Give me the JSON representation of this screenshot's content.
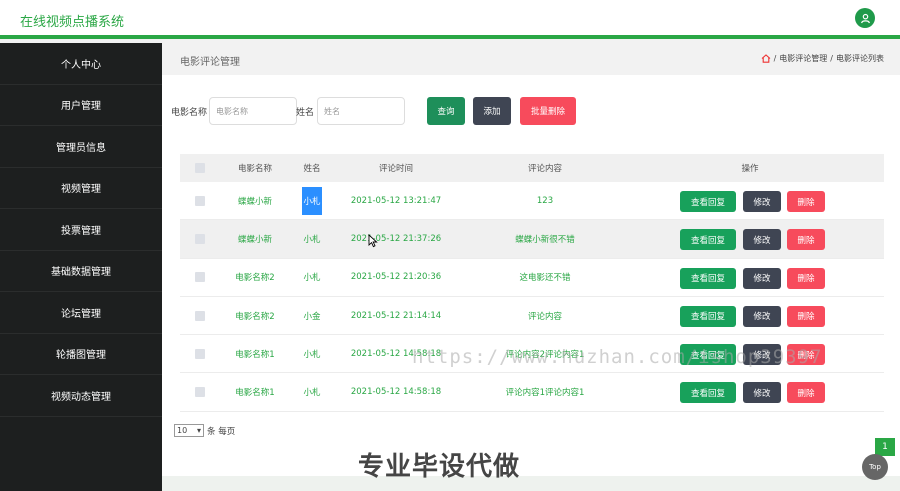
{
  "app": {
    "title": "在线视频点播系统",
    "user_icon": "user-icon"
  },
  "sidebar": {
    "items": [
      {
        "label": "个人中心"
      },
      {
        "label": "用户管理"
      },
      {
        "label": "管理员信息"
      },
      {
        "label": "视频管理"
      },
      {
        "label": "投票管理"
      },
      {
        "label": "基础数据管理"
      },
      {
        "label": "论坛管理"
      },
      {
        "label": "轮播图管理"
      },
      {
        "label": "视频动态管理"
      }
    ]
  },
  "page": {
    "title": "电影评论管理",
    "breadcrumb": {
      "home_icon": "home-icon",
      "sep": "/",
      "level1": "电影评论管理",
      "level2": "电影评论列表"
    }
  },
  "search": {
    "movie_label": "电影名称",
    "movie_placeholder": "电影名称",
    "name_label": "姓名",
    "name_placeholder": "姓名",
    "query_btn": "查询",
    "add_btn": "添加",
    "batch_delete_btn": "批量删除"
  },
  "table": {
    "headers": {
      "movie": "电影名称",
      "name": "姓名",
      "time": "评论时间",
      "content": "评论内容",
      "ops": "操作"
    },
    "rows": [
      {
        "movie": "蝶蝶小新",
        "name": "小札",
        "time": "2021-05-12 13:21:47",
        "content": "123"
      },
      {
        "movie": "蝶蝶小新",
        "name": "小札",
        "time": "2021-05-12 21:37:26",
        "content": "蝶蝶小新很不错"
      },
      {
        "movie": "电影名称2",
        "name": "小札",
        "time": "2021-05-12 21:20:36",
        "content": "这电影还不错"
      },
      {
        "movie": "电影名称2",
        "name": "小金",
        "time": "2021-05-12 21:14:14",
        "content": "评论内容"
      },
      {
        "movie": "电影名称1",
        "name": "小札",
        "time": "2021-05-12 14:58:18",
        "content": "评论内容2评论内容1"
      },
      {
        "movie": "电影名称1",
        "name": "小札",
        "time": "2021-05-12 14:58:18",
        "content": "评论内容1评论内容1"
      }
    ],
    "actions": {
      "view_reply": "查看回复",
      "edit": "修改",
      "delete": "删除"
    }
  },
  "pager": {
    "page_size": "10",
    "per_page_label": "条 每页",
    "current_page": "1",
    "top_label": "Top"
  },
  "overlay": {
    "watermark": "https://www.huzhan.com/ishop39397",
    "caption": "专业毕设代做"
  },
  "colors": {
    "accent": "#2aa745",
    "query": "#1e8f5a",
    "add": "#3f4553",
    "danger": "#f74b5c",
    "view_reply": "#18a15b"
  }
}
